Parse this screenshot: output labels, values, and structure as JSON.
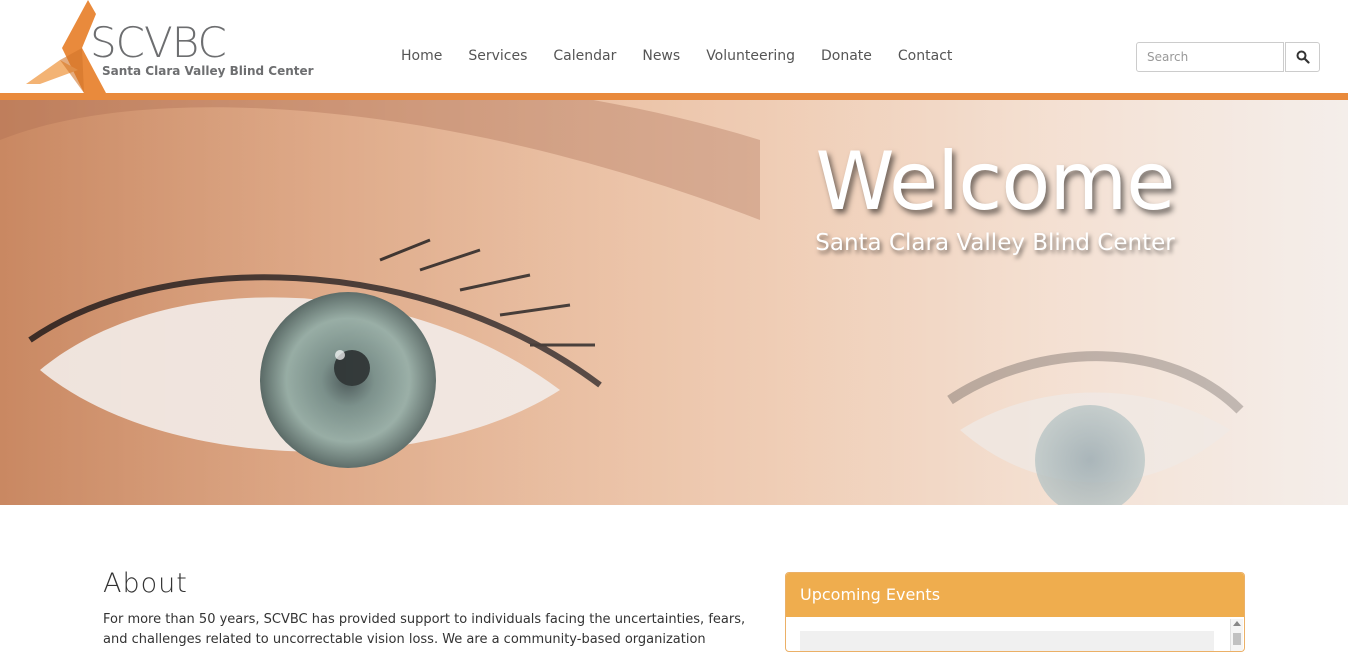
{
  "logo": {
    "title": "SCVBC",
    "subtitle": "Santa Clara Valley Blind Center"
  },
  "nav": {
    "items": [
      {
        "label": "Home"
      },
      {
        "label": "Services"
      },
      {
        "label": "Calendar"
      },
      {
        "label": "News"
      },
      {
        "label": "Volunteering"
      },
      {
        "label": "Donate"
      },
      {
        "label": "Contact"
      }
    ]
  },
  "search": {
    "placeholder": "Search",
    "icon": "search-icon"
  },
  "hero": {
    "title": "Welcome",
    "subtitle": "Santa Clara Valley Blind Center"
  },
  "about": {
    "title": "About",
    "text": "For more than 50 years, SCVBC has provided support to individuals facing the uncertainties, fears, and challenges related to uncorrectable vision loss. We are a community-based organization"
  },
  "events": {
    "title": "Upcoming Events"
  },
  "colors": {
    "accent": "#e98a3c",
    "panel_header": "#efad4e",
    "logo_gray": "#6d6e70"
  }
}
